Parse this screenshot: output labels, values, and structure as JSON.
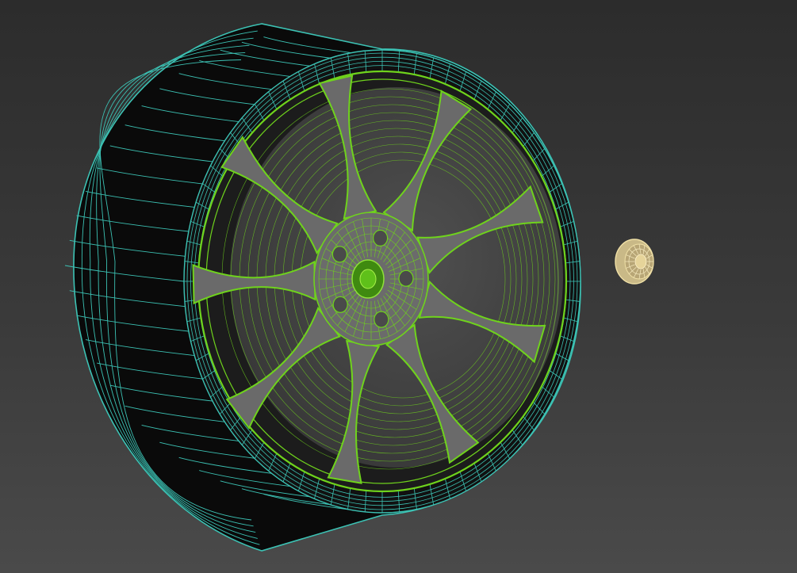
{
  "viewport": {
    "background_top": "#2c2c2c",
    "background_bottom": "#4a4a4a"
  },
  "objects": {
    "tire": {
      "wire_color": "#3cc2b4",
      "fill": "#0b0b0b",
      "spoke_count": 0
    },
    "rim": {
      "wire_color": "#6fd31c",
      "fill": "#6e6e6e",
      "spoke_count": 9,
      "lug_count": 5
    },
    "center_cap": {
      "wire_color": "#f0e0a6",
      "fill": "#c9b987"
    }
  }
}
